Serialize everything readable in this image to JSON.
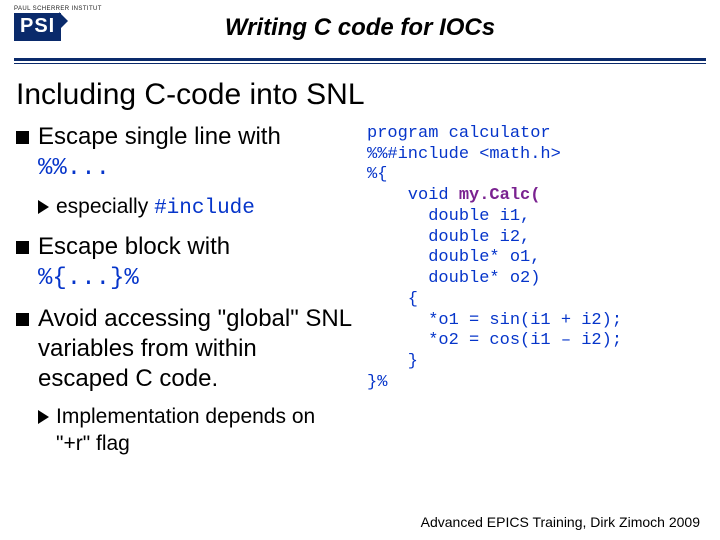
{
  "header": {
    "institute": "PAUL SCHERRER INSTITUT",
    "logo_text": "PSI",
    "title": "Writing C code for IOCs"
  },
  "section_title": "Including C-code into SNL",
  "left": {
    "b1_a_pre": "Escape single line with ",
    "b1_a_code": "%%...",
    "b2_a_pre": "especially ",
    "b2_a_code": "#include",
    "b1_b_pre": "Escape block with ",
    "b1_b_code": "%{...}%",
    "b1_c": "Avoid accessing \"global\" SNL variables from within escaped C code.",
    "b2_b": "Implementation depends on \"+r\" flag"
  },
  "code": {
    "l01": "program calculator",
    "l02": "%%#include <math.h>",
    "l03": "%{",
    "l04": "    void ",
    "l04fn": "my.Calc(",
    "l05": "      double i1,",
    "l06": "      double i2,",
    "l07": "      double* o1,",
    "l08": "      double* o2)",
    "l09": "    {",
    "l10": "      *o1 = sin(i1 + i2);",
    "l11": "      *o2 = cos(i1 – i2);",
    "l12": "    }",
    "l13": "}%"
  },
  "footer": "Advanced EPICS Training, Dirk Zimoch 2009"
}
